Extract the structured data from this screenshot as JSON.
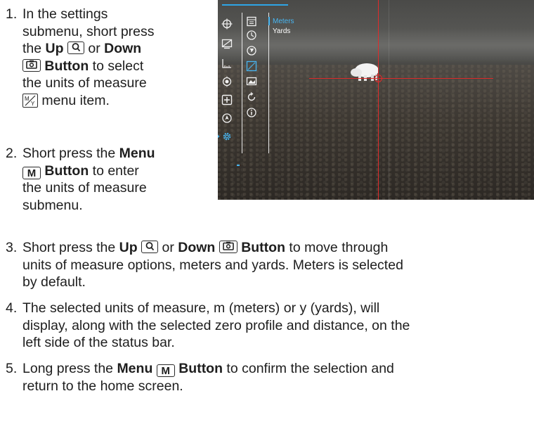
{
  "device_screen": {
    "menu_options": [
      "Meters",
      "Yards"
    ],
    "selected_option": "Meters",
    "accent_color": "#48b6f2",
    "reticle_color": "#e02b2b",
    "left_icons": [
      "crosshair-icon",
      "monitor-brightness-icon",
      "ruler-icon",
      "target-icon",
      "plus-box-icon",
      "compass-icon",
      "settings-gear-icon"
    ],
    "right_icons": [
      "calendar-icon",
      "clock-icon",
      "globe-icon",
      "units-icon",
      "image-icon",
      "reset-icon",
      "info-icon"
    ]
  },
  "steps": [
    {
      "number": "1.",
      "t1": "In the settings",
      "t2": "submenu, short press",
      "t3a": "the ",
      "t3b": "Up",
      "t3c": " or ",
      "t3d": "Down",
      "t4b": "Button",
      "t4c": " to select",
      "t5": "the units of measure",
      "t6": " menu item."
    },
    {
      "number": "2.",
      "t1a": "Short press the ",
      "t1b": "Menu",
      "t2k": "M",
      "t2b": "Button",
      "t2c": " to enter",
      "t3": "the units of measure",
      "t4": "submenu."
    },
    {
      "number": "3.",
      "t1a": "Short press the ",
      "t1b": "Up",
      "t1c": " or ",
      "t1d": "Down",
      "t1e": "Button",
      "t1f": " to move through",
      "t2": "units of measure options, meters and yards. Meters is selected",
      "t3": "by default."
    },
    {
      "number": "4.",
      "t1": "The selected units of measure, m (meters) or y (yards), will",
      "t2": "display, along with the selected zero profile and distance, on the",
      "t3": "left side of the status bar."
    },
    {
      "number": "5.",
      "t1a": "Long press the ",
      "t1b": "Menu",
      "t1k": "M",
      "t1c": "Button",
      "t1d": " to confirm the selection and",
      "t2": "return to the home screen."
    }
  ]
}
